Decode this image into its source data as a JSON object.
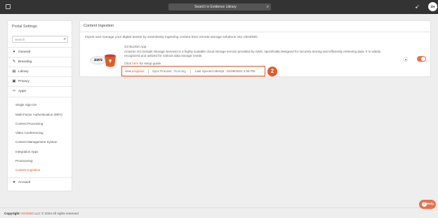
{
  "topbar": {
    "search_label": "Search in Evidence Library",
    "search_icon": "search-icon",
    "notification_icon": "rocket-icon",
    "avatar_initials": "ZH"
  },
  "sidebar": {
    "title": "Portal Settings",
    "search_placeholder": "Search",
    "items": [
      {
        "label": "General",
        "icon": "globe-icon",
        "glyph": "●"
      },
      {
        "label": "Branding",
        "icon": "brush-icon",
        "glyph": "✎"
      },
      {
        "label": "Library",
        "icon": "book-icon",
        "glyph": "▤"
      },
      {
        "label": "Privacy",
        "icon": "lock-icon",
        "glyph": "▣"
      },
      {
        "label": "Apps",
        "icon": "apps-icon",
        "glyph": "⇨"
      }
    ],
    "subitems": [
      "Single Sign-On",
      "Multi-Factor Authentication (MFA)",
      "Content Processing",
      "Video Conferencing",
      "Content Management System",
      "Integration Apps",
      "Provisioning",
      "Content Ingestion"
    ],
    "active_subitem": "Content Ingestion",
    "account": {
      "label": "Account",
      "icon": "user-circle-icon",
      "glyph": "●"
    }
  },
  "main": {
    "title": "Content Ingestion",
    "description": "Import and manage your digital assets by seamlessly ingesting content from remote storage solutions into VIDIZMO.",
    "app": {
      "name": "S3 Bucket App",
      "description": "Amazon S3 (Simple Storage Service) is a highly scalable cloud storage service provided by AWS, specifically designed for securely storing and efficiently retrieving data. It is widely recognized and utilized for various data storage needs.",
      "setup_prefix": "Click",
      "setup_link": "here",
      "setup_suffix": "for setup guide",
      "logo_text": "aws",
      "status": {
        "view_label": "view",
        "progress_label": "progress",
        "sync_label": "Sync Process :",
        "sync_value": "Running",
        "last_synced_label": "Last Synced Attempt :",
        "last_synced_value": "01/09/2024 3:36 PM"
      },
      "step_badge": "2",
      "enabled": true
    }
  },
  "footer": {
    "copyright_label": "Copyright",
    "brand": "VIDIZMO",
    "rest": "LLC © 2024 All rights reserved"
  },
  "help": {
    "label": "Help",
    "icon": "question-icon"
  },
  "colors": {
    "accent": "#e05a2b",
    "topbar": "#333333",
    "link_blue": "#4a8bd0"
  }
}
